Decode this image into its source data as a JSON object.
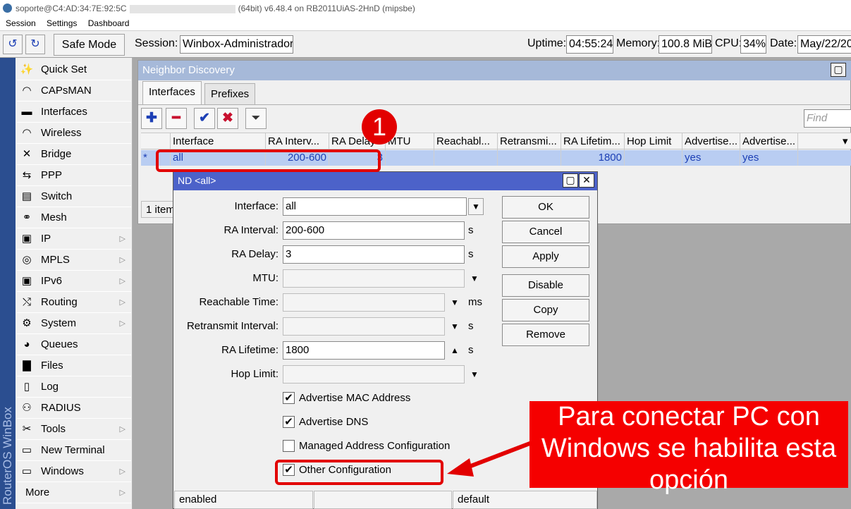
{
  "titlebar": {
    "left": "soporte@C4:AD:34:7E:92:5C",
    "right": "(64bit) v6.48.4 on RB2011UiAS-2HnD (mipsbe)"
  },
  "menu": [
    "Session",
    "Settings",
    "Dashboard"
  ],
  "toolbar": {
    "safe_mode": "Safe Mode",
    "session_label": "Session:",
    "session_value": "Winbox-Administrador",
    "uptime_label": "Uptime:",
    "uptime_value": "04:55:24",
    "memory_label": "Memory:",
    "memory_value": "100.8 MiB",
    "cpu_label": "CPU:",
    "cpu_value": "34%",
    "date_label": "Date:",
    "date_value": "May/22/20"
  },
  "vertical_brand": "RouterOS WinBox",
  "sidebar": [
    {
      "label": "Quick Set",
      "icon": "wand-icon",
      "glyph": "✨",
      "submenu": false
    },
    {
      "label": "CAPsMAN",
      "icon": "wireless-icon",
      "glyph": "◠",
      "submenu": false
    },
    {
      "label": "Interfaces",
      "icon": "interfaces-icon",
      "glyph": "▬",
      "submenu": false
    },
    {
      "label": "Wireless",
      "icon": "wireless-icon",
      "glyph": "◠",
      "submenu": false
    },
    {
      "label": "Bridge",
      "icon": "bridge-icon",
      "glyph": "✕",
      "submenu": false
    },
    {
      "label": "PPP",
      "icon": "ppp-icon",
      "glyph": "⇆",
      "submenu": false
    },
    {
      "label": "Switch",
      "icon": "switch-icon",
      "glyph": "▤",
      "submenu": false
    },
    {
      "label": "Mesh",
      "icon": "mesh-icon",
      "glyph": "⚭",
      "submenu": false
    },
    {
      "label": "IP",
      "icon": "ip-icon",
      "glyph": "▣",
      "submenu": true
    },
    {
      "label": "MPLS",
      "icon": "mpls-icon",
      "glyph": "◎",
      "submenu": true
    },
    {
      "label": "IPv6",
      "icon": "ipv6-icon",
      "glyph": "▣",
      "submenu": true
    },
    {
      "label": "Routing",
      "icon": "routing-icon",
      "glyph": "⤭",
      "submenu": true
    },
    {
      "label": "System",
      "icon": "gear-icon",
      "glyph": "⚙",
      "submenu": true
    },
    {
      "label": "Queues",
      "icon": "queues-icon",
      "glyph": "◕",
      "submenu": false
    },
    {
      "label": "Files",
      "icon": "folder-icon",
      "glyph": "▇",
      "submenu": false
    },
    {
      "label": "Log",
      "icon": "log-icon",
      "glyph": "▯",
      "submenu": false
    },
    {
      "label": "RADIUS",
      "icon": "radius-icon",
      "glyph": "⚇",
      "submenu": false
    },
    {
      "label": "Tools",
      "icon": "tools-icon",
      "glyph": "✂",
      "submenu": true
    },
    {
      "label": "New Terminal",
      "icon": "terminal-icon",
      "glyph": "▭",
      "submenu": false
    },
    {
      "label": "Windows",
      "icon": "windows-icon",
      "glyph": "▭",
      "submenu": true
    },
    {
      "label": "More",
      "icon": "",
      "glyph": "",
      "submenu": true
    }
  ],
  "nd_window": {
    "title": "Neighbor Discovery",
    "tabs": [
      "Interfaces",
      "Prefixes"
    ],
    "find_placeholder": "Find",
    "columns": [
      "Interface",
      "RA Interv...",
      "RA Delay",
      "MTU",
      "Reachabl...",
      "Retransmi...",
      "RA Lifetim...",
      "Hop Limit",
      "Advertise...",
      "Advertise..."
    ],
    "row": {
      "marker": "*",
      "interface": "all",
      "ra_interval": "200-600",
      "ra_delay": "3",
      "mtu": "",
      "reachable": "",
      "retransmit": "",
      "ra_lifetime": "1800",
      "hop_limit": "",
      "adv1": "yes",
      "adv2": "yes"
    },
    "status": "1 item"
  },
  "dialog": {
    "title": "ND <all>",
    "fields": {
      "interface": {
        "label": "Interface:",
        "value": "all"
      },
      "ra_interval": {
        "label": "RA Interval:",
        "value": "200-600",
        "unit": "s"
      },
      "ra_delay": {
        "label": "RA Delay:",
        "value": "3",
        "unit": "s"
      },
      "mtu": {
        "label": "MTU:",
        "value": ""
      },
      "reachable_time": {
        "label": "Reachable Time:",
        "value": "",
        "unit": "ms"
      },
      "retransmit_interval": {
        "label": "Retransmit Interval:",
        "value": "",
        "unit": "s"
      },
      "ra_lifetime": {
        "label": "RA Lifetime:",
        "value": "1800",
        "unit": "s"
      },
      "hop_limit": {
        "label": "Hop Limit:",
        "value": ""
      }
    },
    "checkboxes": [
      {
        "label": "Advertise MAC Address",
        "checked": true
      },
      {
        "label": "Advertise DNS",
        "checked": true
      },
      {
        "label": "Managed Address Configuration",
        "checked": false
      },
      {
        "label": "Other Configuration",
        "checked": true
      }
    ],
    "buttons": [
      "OK",
      "Cancel",
      "Apply",
      "Disable",
      "Copy",
      "Remove"
    ],
    "status_left": "enabled",
    "status_right": "default"
  },
  "annotation": {
    "badge": "1",
    "callout": "Para conectar PC con Windows se habilita esta opción",
    "accent": "#e20000"
  }
}
